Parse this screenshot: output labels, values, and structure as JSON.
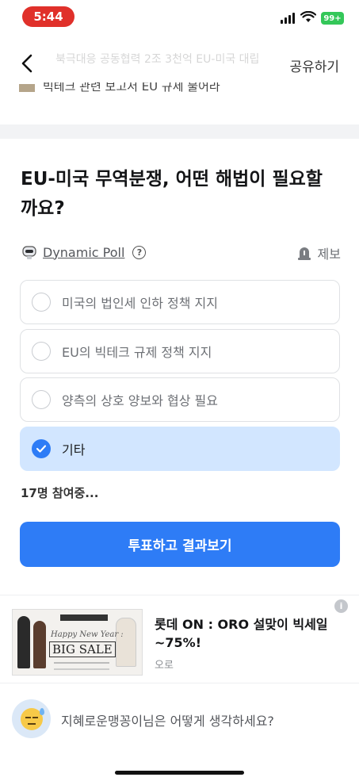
{
  "status_bar": {
    "time": "5:44",
    "battery": "99+"
  },
  "header": {
    "share_label": "공유하기",
    "faded_title": "북극대응 공동협력 2조 3천억 EU-미국 대립",
    "article_strip_text": "빅테크 관련 보고서 EU 규제 불어라"
  },
  "poll": {
    "title": "EU-미국 무역분쟁, 어떤 해법이 필요할까요?",
    "kind_label": "Dynamic Poll",
    "report_label": "제보",
    "options": [
      {
        "label": "미국의 법인세 인하 정책 지지",
        "selected": false
      },
      {
        "label": "EU의 빅테크 규제 정책 지지",
        "selected": false
      },
      {
        "label": "양측의 상호 양보와 협상 필요",
        "selected": false
      },
      {
        "label": "기타",
        "selected": true
      }
    ],
    "participants": "17명 참여중...",
    "vote_button": "투표하고 결과보기"
  },
  "ad": {
    "image_text_top": "Happy New Year :",
    "image_text_big": "BIG SALE",
    "title": "롯데 ON : ORO 설맞이 빅세일 ~75%!",
    "brand": "오로"
  },
  "comment": {
    "prompt": "지혜로운맹꽁이님은 어떻게 생각하세요?"
  },
  "colors": {
    "accent": "#2e7cf6",
    "selected_bg": "#d2e6ff",
    "time_pill": "#e0302a",
    "battery": "#34c759"
  }
}
